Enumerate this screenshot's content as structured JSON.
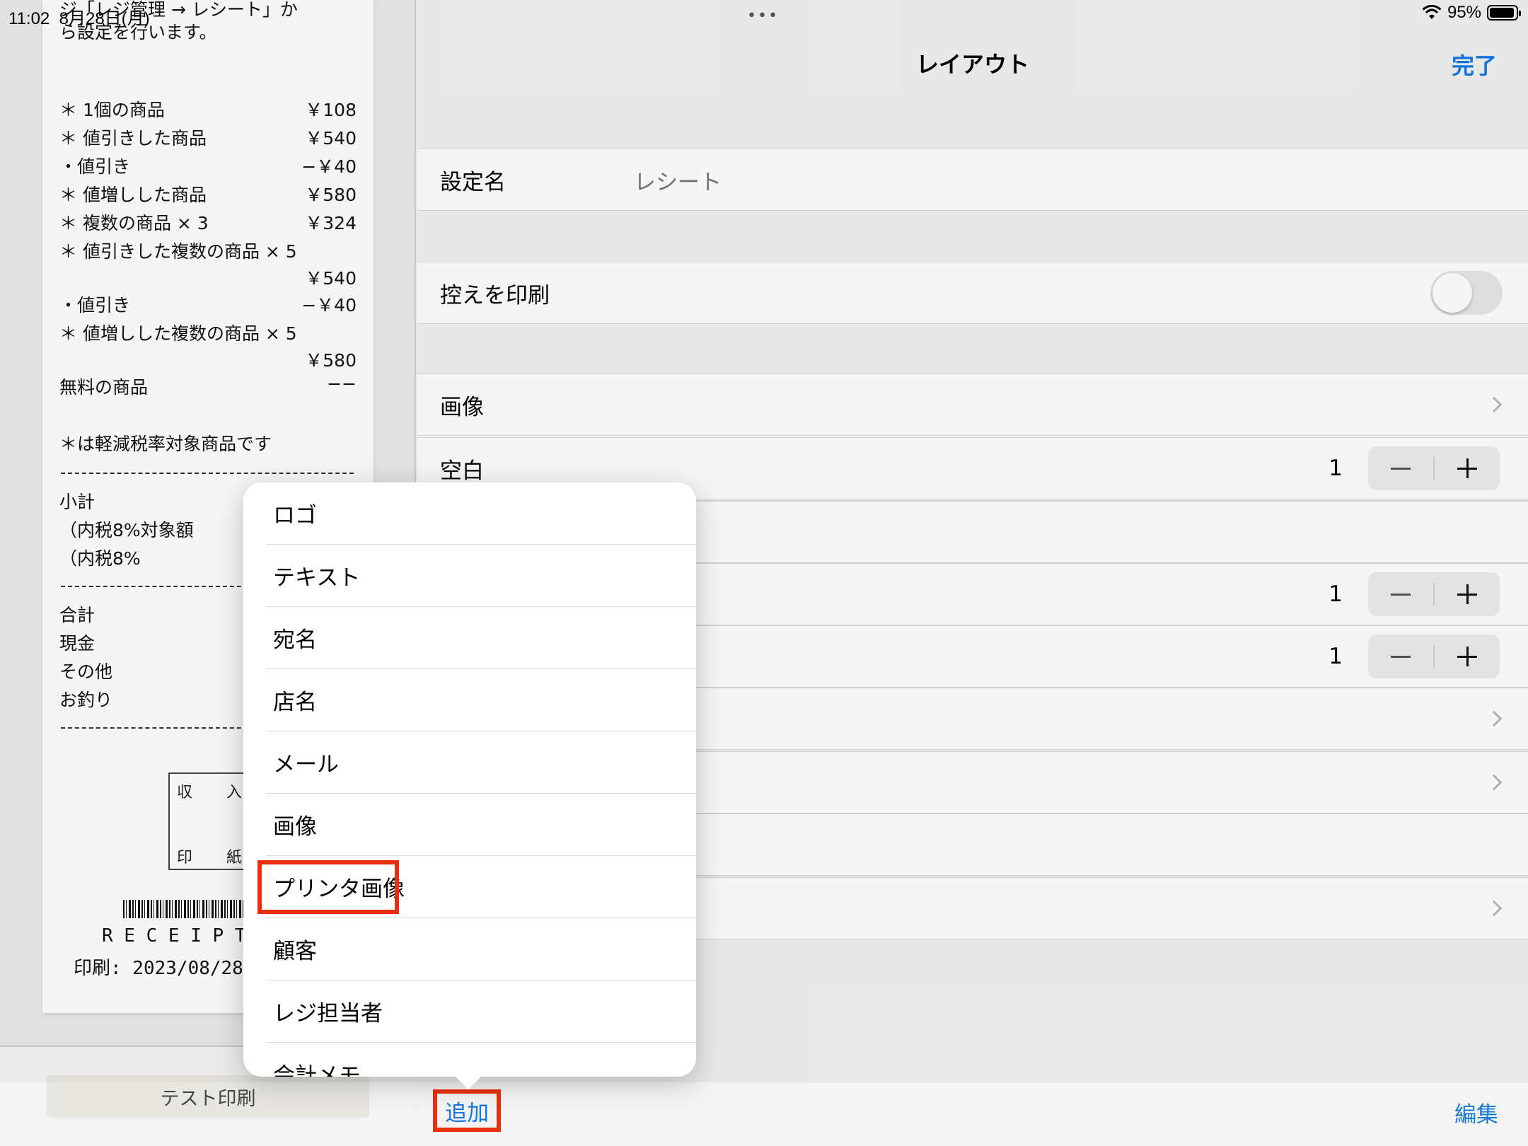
{
  "status_bar": {
    "time": "11:02",
    "date": "8月28日(月)",
    "battery": "95%",
    "battery_level": 0.95
  },
  "receipt": {
    "intro_line1": "ジ「レジ管理 → レシート」か",
    "intro_line2": "ら設定を行います。",
    "items": [
      {
        "label": "＊ 1個の商品",
        "price": "￥108"
      },
      {
        "label": "＊ 値引きした商品",
        "price": "￥540"
      },
      {
        "label": "・値引き",
        "price": "−￥40"
      },
      {
        "label": "＊ 値増しした商品",
        "price": "￥580"
      },
      {
        "label": "＊ 複数の商品 × 3",
        "price": "￥324"
      },
      {
        "label": "＊ 値引きした複数の商品 × 5",
        "price": ""
      },
      {
        "label": "",
        "price": "￥540"
      },
      {
        "label": "・値引き",
        "price": "−￥40"
      },
      {
        "label": "＊ 値増しした複数の商品 × 5",
        "price": ""
      },
      {
        "label": "",
        "price": "￥580"
      },
      {
        "label": "無料の商品",
        "price": "−−"
      }
    ],
    "tax_note": "＊は軽減税率対象商品です",
    "subtotal": "小計",
    "tax_base": "（内税8%対象額",
    "tax": "（内税8%",
    "total": "合計",
    "cash": "現金",
    "other": "その他",
    "change": "お釣り",
    "stamp_chars": [
      "収",
      "入",
      "印",
      "紙"
    ],
    "receipt_word": "R E C E I P T",
    "printed": "印刷: 2023/08/28"
  },
  "test_print_label": "テスト印刷",
  "nav": {
    "title": "レイアウト",
    "done": "完了"
  },
  "settings": {
    "name_label": "設定名",
    "name_value": "レシート",
    "copy_label": "控えを印刷",
    "copy_enabled": false,
    "image_label": "画像",
    "blank_label": "空白",
    "blank_value": "1",
    "stepper2_value": "1",
    "stepper3_value": "1"
  },
  "bottom": {
    "add": "追加",
    "edit": "編集"
  },
  "popover_items": [
    "ロゴ",
    "テキスト",
    "宛名",
    "店名",
    "メール",
    "画像",
    "プリンタ画像",
    "顧客",
    "レジ担当者",
    "会計メモ"
  ],
  "colors": {
    "accent": "#1578e0",
    "highlight": "#e8300f"
  }
}
